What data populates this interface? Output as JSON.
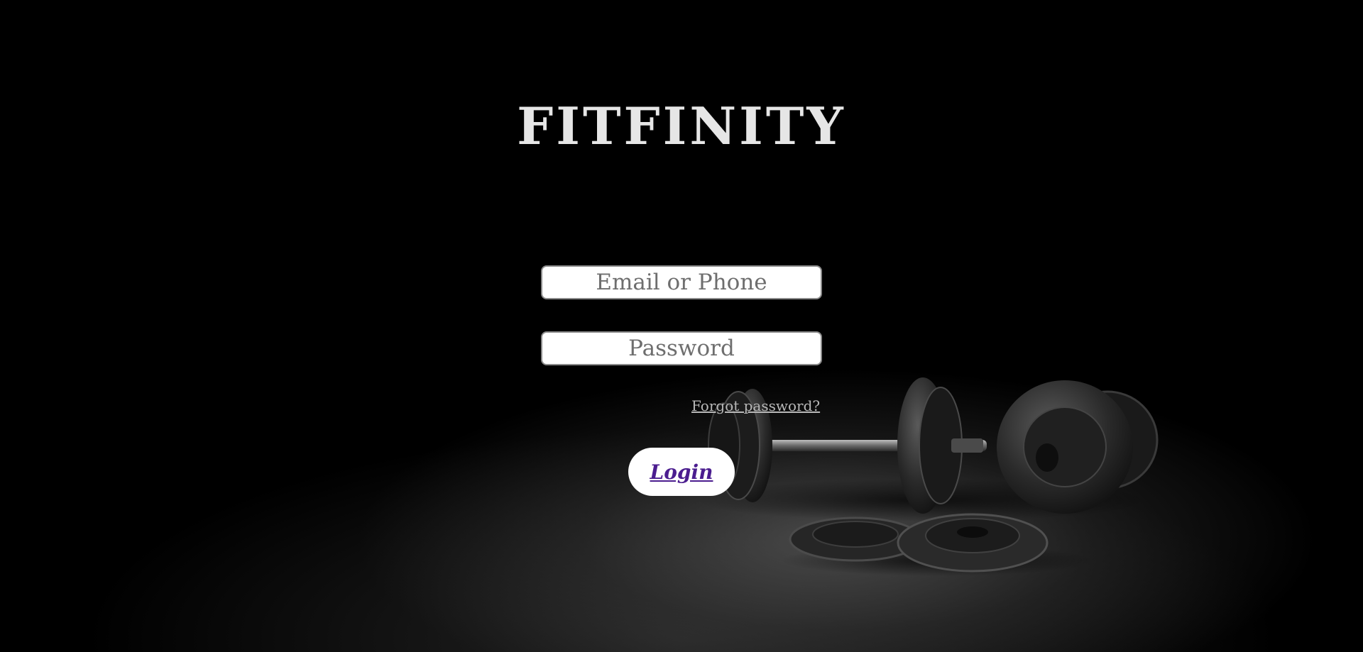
{
  "brand": {
    "name": "FITFINITY"
  },
  "form": {
    "email_placeholder": "Email or Phone",
    "password_placeholder": "Password",
    "forgot_label": "Forgot password?",
    "login_label": "Login"
  },
  "colors": {
    "background": "#000000",
    "logo": "#e6e6e6",
    "login_text": "#4b1d8f",
    "forgot_link": "#b8b8b8"
  }
}
